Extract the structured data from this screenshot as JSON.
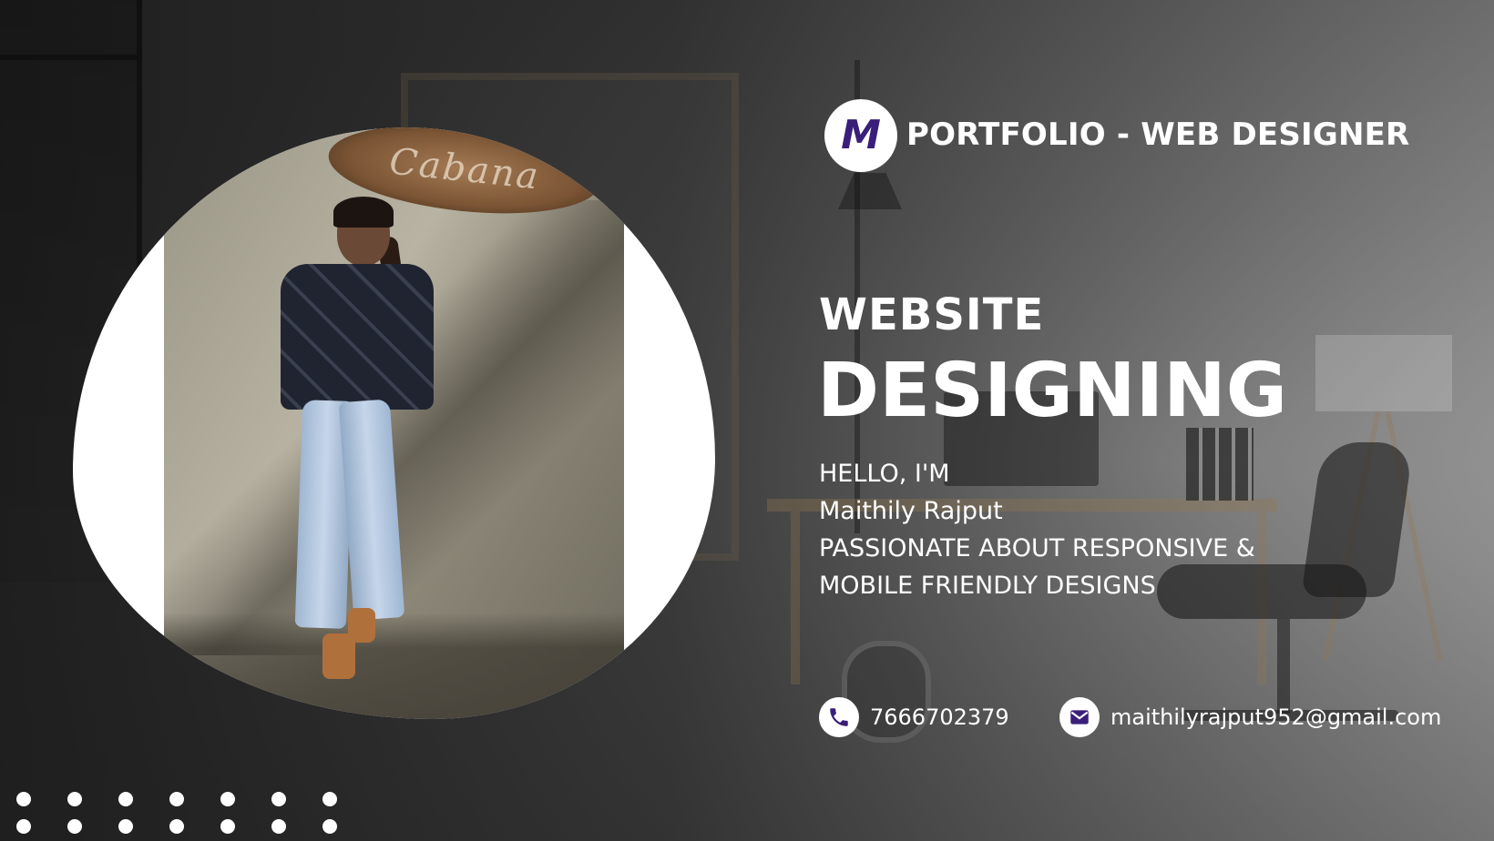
{
  "header": {
    "logo_letter": "M",
    "title": "PORTFOLIO - WEB DESIGNER"
  },
  "headline": {
    "small": "WEBSITE",
    "big": "DESIGNING"
  },
  "intro": {
    "greeting": "HELLO, I'M",
    "name": "Maithily Rajput",
    "tagline_1": "PASSIONATE ABOUT RESPONSIVE &",
    "tagline_2": "MOBILE FRIENDLY DESIGNS"
  },
  "contact": {
    "phone": "7666702379",
    "email": "maithilyrajput952@gmail.com",
    "phone_icon": "phone-icon",
    "email_icon": "mail-icon"
  },
  "photo": {
    "sign_text": "Cabana"
  },
  "colors": {
    "logo_accent": "#3a1f7a",
    "text": "#ffffff"
  },
  "decoration": {
    "dot_rows": 2,
    "dot_columns": 7
  }
}
